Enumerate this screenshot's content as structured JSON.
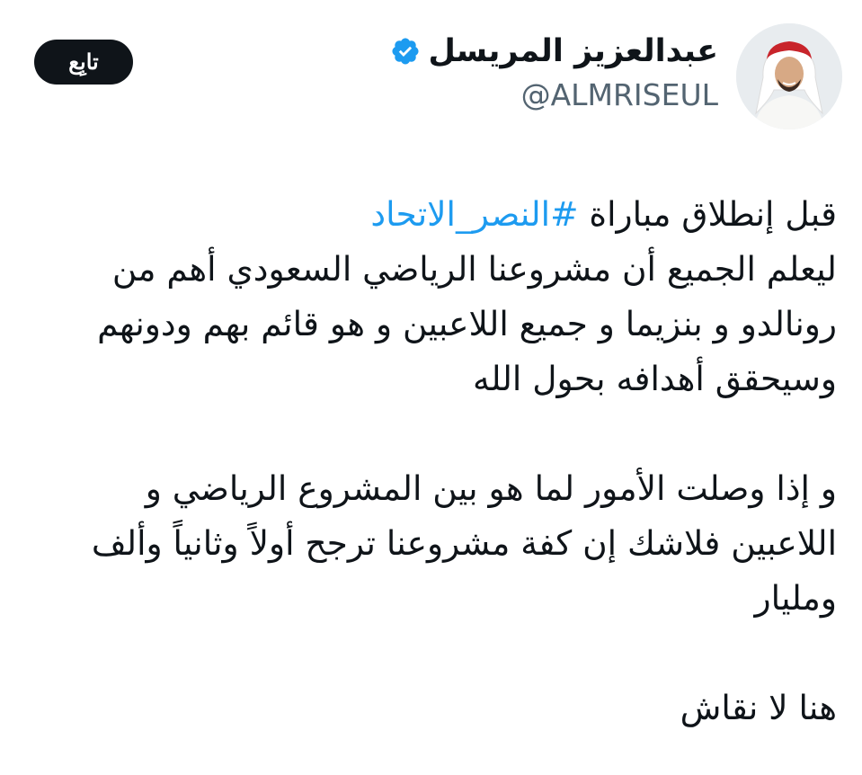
{
  "author": {
    "display_name": "عبدالعزيز المريسل",
    "handle": "@ALMRISEUL",
    "verified_icon": "verified-badge-icon",
    "verified_color": "#1d9bf0"
  },
  "follow_button": {
    "label": "تابِع"
  },
  "tweet": {
    "line1_prefix": "قبل إنطلاق مباراة ",
    "hashtag": "#النصر_الاتحاد",
    "line2": "ليعلم الجميع أن مشروعنا الرياضي السعودي أهم من",
    "line3": "رونالدو و بنزيما و جميع اللاعبين و هو قائم بهم ودونهم",
    "line4": "وسيحقق أهدافه بحول الله",
    "line5": "و إذا وصلت الأمور لما هو بين المشروع الرياضي و",
    "line6": "اللاعبين فلاشك إن كفة مشروعنا ترجح أولاً وثانياً وألف",
    "line7": "ومليار",
    "line8": "هنا لا نقاش"
  },
  "colors": {
    "text": "#0f1419",
    "secondary": "#536471",
    "link": "#1d9bf0",
    "button_bg": "#0f1419"
  }
}
